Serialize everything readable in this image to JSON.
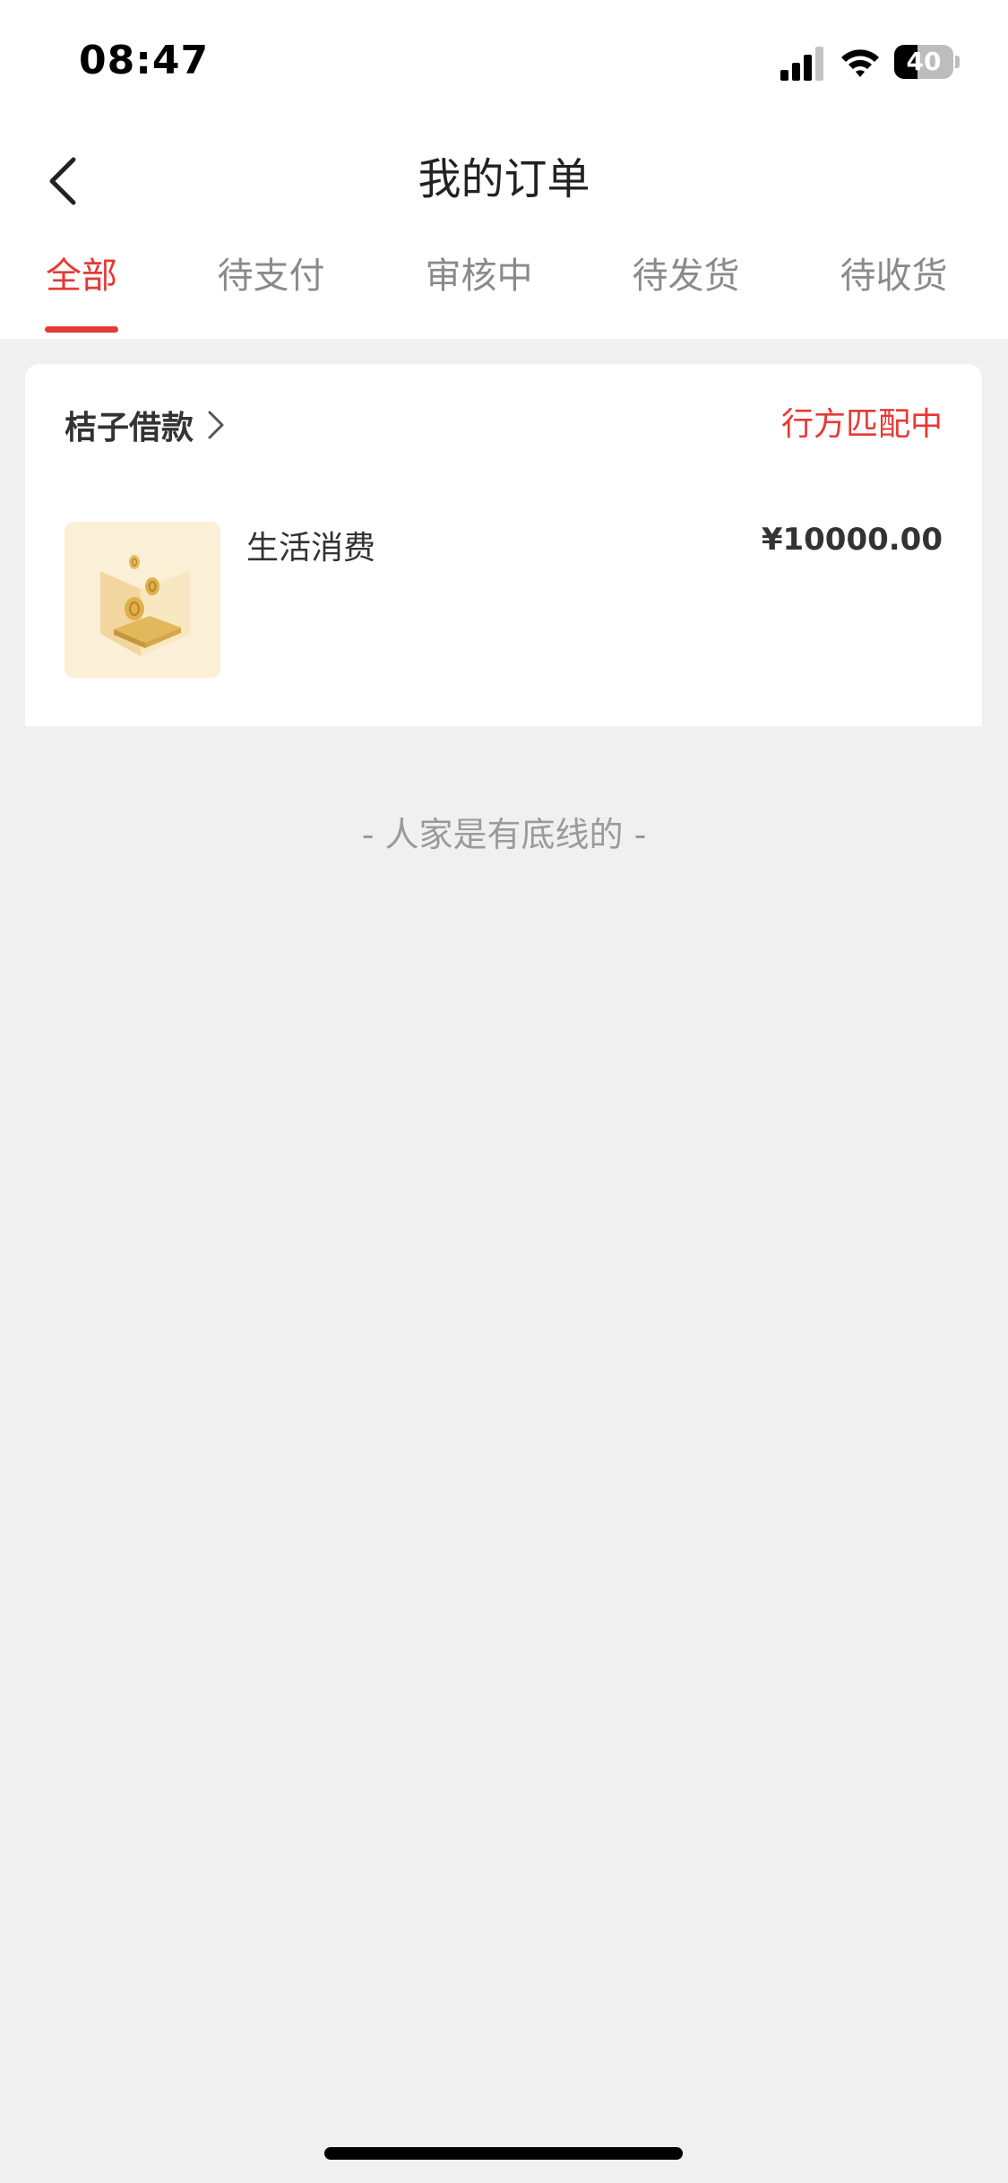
{
  "status_bar": {
    "time": "08:47",
    "battery_level": "40",
    "battery_fraction": 0.4
  },
  "nav": {
    "title": "我的订单",
    "back_icon": "chevron-left-icon"
  },
  "tabs": [
    {
      "label": "全部",
      "active": true
    },
    {
      "label": "待支付",
      "active": false
    },
    {
      "label": "审核中",
      "active": false
    },
    {
      "label": "待发货",
      "active": false
    },
    {
      "label": "待收货",
      "active": false
    }
  ],
  "order": {
    "shop_name": "桔子借款",
    "status": "行方匹配中",
    "product_name": "生活消费",
    "price": "¥10000.00"
  },
  "footer": {
    "end_text": "- 人家是有底线的 -"
  },
  "colors": {
    "accent": "#e53935",
    "background": "#f0f0f0"
  }
}
